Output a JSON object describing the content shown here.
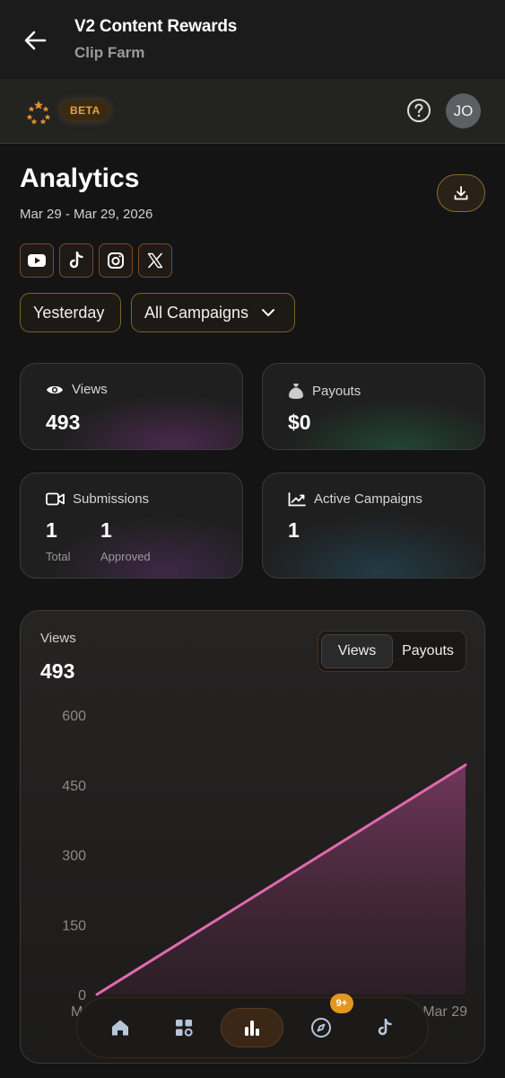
{
  "header": {
    "title": "V2 Content Rewards",
    "subtitle": "Clip Farm",
    "back_icon": "arrow-left-icon"
  },
  "brandbar": {
    "logo_icon": "stars-logo-icon",
    "beta_label": "BETA",
    "help_icon": "question-circle-icon",
    "avatar_initials": "JO"
  },
  "analytics": {
    "title": "Analytics",
    "date_range": "Mar 29 - Mar 29, 2026",
    "download_icon": "download-icon",
    "platforms": [
      "youtube-icon",
      "tiktok-icon",
      "instagram-icon",
      "x-icon"
    ],
    "filters": {
      "period": "Yesterday",
      "campaign": "All Campaigns"
    }
  },
  "stats": {
    "views": {
      "label": "Views",
      "value": "493",
      "icon": "eye-icon"
    },
    "payouts": {
      "label": "Payouts",
      "value": "$0",
      "icon": "money-bag-icon"
    },
    "submissions": {
      "label": "Submissions",
      "total_value": "1",
      "total_label": "Total",
      "approved_value": "1",
      "approved_label": "Approved",
      "icon": "video-camera-icon"
    },
    "active_campaigns": {
      "label": "Active Campaigns",
      "value": "1",
      "icon": "trend-up-icon"
    }
  },
  "chart": {
    "label": "Views",
    "value": "493",
    "toggle": [
      "Views",
      "Payouts"
    ],
    "active_toggle": "Views",
    "line_color": "#e06aae"
  },
  "chart_data": {
    "type": "area",
    "x": [
      "Mar 29",
      "Mar 29"
    ],
    "tick_x_left": "M",
    "tick_x_right": "Mar 29",
    "yticks": [
      "600",
      "450",
      "300",
      "150",
      "0"
    ],
    "values": [
      0,
      493
    ],
    "ylim": [
      0,
      600
    ],
    "grid": false
  },
  "bottom_nav": {
    "items": [
      "home-icon",
      "apps-icon",
      "bar-chart-icon",
      "compass-icon",
      "tiktok-icon"
    ],
    "active": "bar-chart-icon",
    "badge": "9+"
  }
}
